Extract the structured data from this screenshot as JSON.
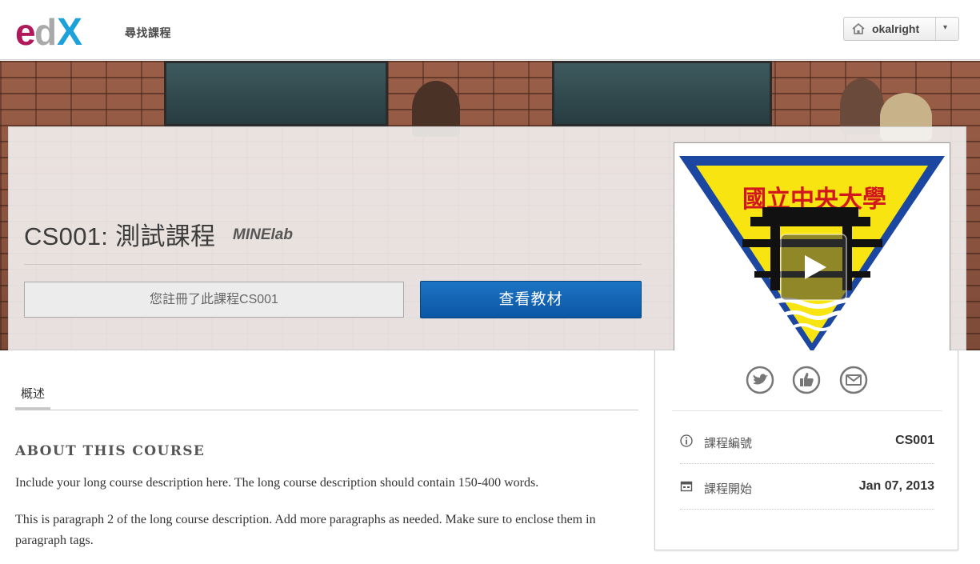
{
  "header": {
    "logo_text": "edX",
    "nav_find_courses": "尋找課程",
    "username": "okalright",
    "caret": "▾"
  },
  "course": {
    "title": "CS001: 測試課程",
    "org": "MINElab",
    "registered_text": "您註冊了此課程CS001",
    "view_courseware_label": "查看教材",
    "video_logo_text": "國立中央大學"
  },
  "tabs": [
    {
      "label": "概述"
    }
  ],
  "about": {
    "heading": "ABOUT THIS COURSE",
    "paragraphs": [
      "Include your long course description here. The long course description should contain 150-400 words.",
      "This is paragraph 2 of the long course description. Add more paragraphs as needed. Make sure to enclose them in paragraph tags."
    ]
  },
  "sidebar": {
    "share_icons": [
      "twitter-icon",
      "facebook-like-icon",
      "email-icon"
    ],
    "info": [
      {
        "icon": "info-icon",
        "label": "課程編號",
        "value": "CS001"
      },
      {
        "icon": "calendar-icon",
        "label": "課程開始",
        "value": "Jan 07, 2013"
      }
    ]
  },
  "colors": {
    "primary_button": "#0a56a4",
    "logo_magenta": "#b1185b",
    "logo_blue": "#1da1db"
  }
}
